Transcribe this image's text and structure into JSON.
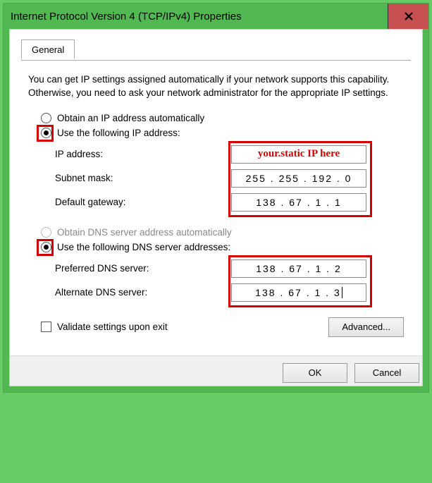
{
  "window": {
    "title": "Internet Protocol Version 4 (TCP/IPv4) Properties"
  },
  "tab": {
    "general": "General"
  },
  "description": "You can get IP settings assigned automatically if your network supports this capability. Otherwise, you need to ask your network administrator for the appropriate IP settings.",
  "ip_section": {
    "auto_label": "Obtain an IP address automatically",
    "manual_label": "Use the following IP address:",
    "selected": "manual",
    "fields": {
      "ip_address_label": "IP address:",
      "ip_address_value": "your.static IP here",
      "subnet_label": "Subnet mask:",
      "subnet_value": "255 . 255 . 192 .   0",
      "gateway_label": "Default gateway:",
      "gateway_value": "138 .  67  .   1   .   1"
    }
  },
  "dns_section": {
    "auto_label": "Obtain DNS server address automatically",
    "manual_label": "Use the following DNS server addresses:",
    "selected": "manual",
    "auto_disabled": true,
    "fields": {
      "preferred_label": "Preferred DNS server:",
      "preferred_value": "138 .  67  .   1   .   2",
      "alternate_label": "Alternate DNS server:",
      "alternate_value": "138 .  67  .   1   .   3"
    }
  },
  "validate_label": "Validate settings upon exit",
  "advanced_label": "Advanced...",
  "buttons": {
    "ok": "OK",
    "cancel": "Cancel"
  },
  "highlights": {
    "ip_manual_radio": true,
    "ip_fields_box": true,
    "dns_manual_radio": true,
    "dns_fields_box": true
  }
}
